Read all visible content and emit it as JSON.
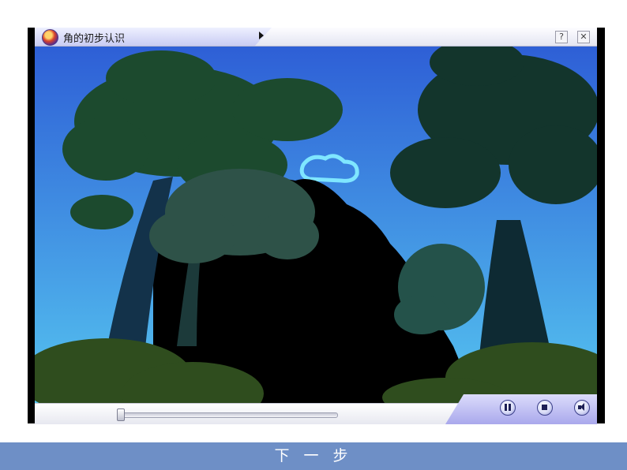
{
  "player": {
    "title": "角的初步认识",
    "help_label": "?",
    "close_label": "✕",
    "icons": {
      "logo": "app-logo-icon",
      "arrow": "play-arrow-icon",
      "pause": "pause-icon",
      "stop": "stop-icon",
      "volume": "volume-icon"
    },
    "progress": 0.0
  },
  "footer": {
    "next_label": "下 一 步"
  },
  "colors": {
    "next_bar": "#6e8fc6",
    "sky_top": "#2e5fd6",
    "sky_bottom": "#55c4f0",
    "control_accent": "#a9a8ec"
  }
}
